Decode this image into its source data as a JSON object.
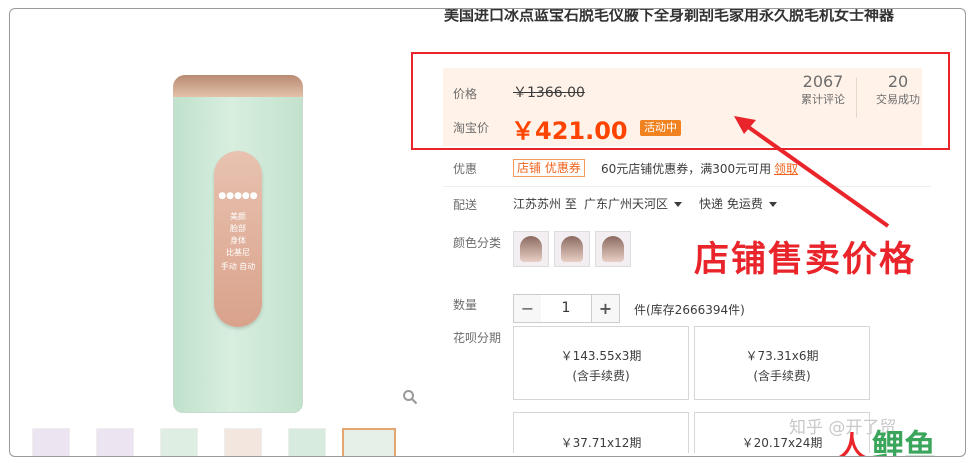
{
  "product": {
    "title": "美国进口冰点蓝宝石脱毛仪腋下全身剃刮毛家用永久脱毛机女士神器",
    "panel_lines": [
      "美颜",
      "脸部",
      "身体",
      "比基尼",
      "手动 自动"
    ]
  },
  "price": {
    "label": "价格",
    "original": "￥1366.00",
    "taobao_label": "淘宝价",
    "taobao_price": "￥421.00",
    "badge": "活动中",
    "reviews_count": "2067",
    "reviews_label": "累计评论",
    "sales_count": "20",
    "sales_label": "交易成功"
  },
  "coupon": {
    "label": "优惠",
    "tag": "店铺 优惠券",
    "text": "60元店铺优惠券，满300元可用",
    "link": "领取"
  },
  "shipping": {
    "label": "配送",
    "from": "江苏苏州 至",
    "to": "广东广州天河区",
    "method": "快递 免运费"
  },
  "color": {
    "label": "颜色分类"
  },
  "callout": "店铺售卖价格",
  "quantity": {
    "label": "数量",
    "minus": "−",
    "value": "1",
    "plus": "+",
    "stock": "件(库存2666394件)"
  },
  "installments": {
    "label": "花呗分期",
    "options": [
      {
        "amount": "￥143.55x3期",
        "fee": "(含手续费)"
      },
      {
        "amount": "￥73.31x6期",
        "fee": "(含手续费)"
      },
      {
        "amount": "￥37.71x12期",
        "fee": ""
      },
      {
        "amount": "￥20.17x24期",
        "fee": ""
      }
    ]
  },
  "watermark": {
    "text": "知乎 @开了贸",
    "logo_a": "人",
    "logo_b": "鲤鱼"
  },
  "colors": {
    "accent": "#ff4400",
    "red_annotation": "#e9242a",
    "price_bg": "#fff2e8"
  },
  "icons": {
    "zoom": "magnifier-icon"
  }
}
